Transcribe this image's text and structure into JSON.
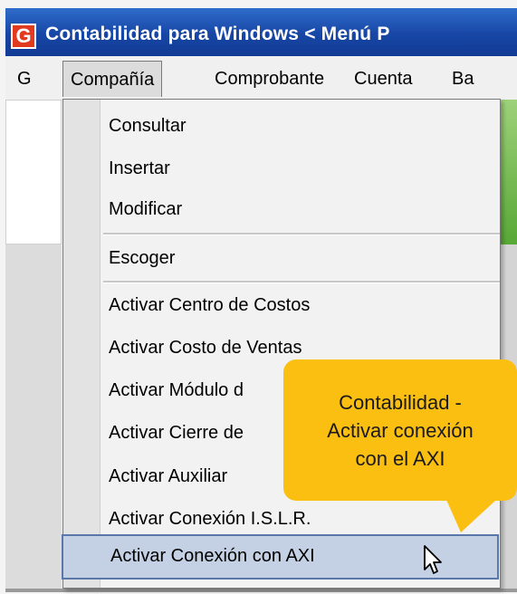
{
  "window": {
    "title": "Contabilidad para Windows < Menú P",
    "app_icon_letter": "G"
  },
  "menubar": {
    "items": [
      "G",
      "Compañía",
      "Comprobante",
      "Cuenta",
      "Ba"
    ]
  },
  "dropdown": {
    "items": [
      "Consultar",
      "Insertar",
      "Modificar",
      "Escoger",
      "Activar Centro de Costos",
      "Activar Costo de Ventas",
      "Activar Módulo d",
      "Activar Cierre de",
      "Activar Auxiliar",
      "Activar Conexión I.S.L.R.",
      "Activar Conexión con AXI"
    ],
    "selected_index": 10
  },
  "tooltip": {
    "lines": [
      "Contabilidad -",
      "Activar conexión",
      "con el AXI"
    ],
    "color": "#fbbf12"
  },
  "icons": [
    "app-icon",
    "mouse-pointer-icon"
  ]
}
